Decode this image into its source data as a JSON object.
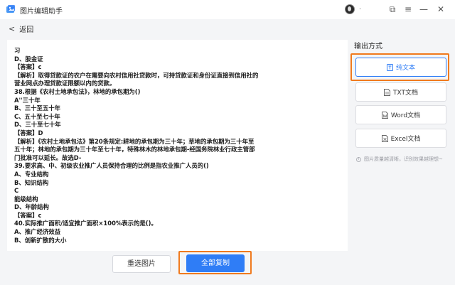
{
  "app": {
    "title": "图片编辑助手",
    "user_name": "."
  },
  "window_controls": {
    "restore": "⧉",
    "menu": "≡",
    "minimize": "—",
    "close": "✕"
  },
  "nav": {
    "back_label": "返回"
  },
  "content": {
    "lines": [
      "习",
      "D、股金证",
      "【答案】c",
      "【解析】取得贷款证的农户在需要向农村信用社贷款时，可持贷款证和身份证直接到信用社的",
      "营业网点办理贷款证限额以内的贷款。",
      "38.根据《农村土地承包法》，林地的承包期为()",
      "A''三十年",
      "B、三十至五十年",
      "C、五十至七十年",
      "D、三十至七十年",
      "【答案】D",
      "【解析】《农村土地承包法》第20条规定:耕地的承包期为三十年；草地的承包期为三十年至",
      "五十年；林地的承包期为三十年至七十年，特殊林木的林地承包期-经国务院林业行政主管部",
      "门批准可以延长。故选D-",
      "39.要求高、中、初级农业推广人员保持合理的比例是指农业推广人员的()",
      "A、专业结构",
      "B、知识结构",
      "C",
      "能级结构",
      "D、年龄结构",
      "【答案】c",
      "40.实际推广面积/适宜推广面积×100%表示的是()。",
      "A、推广经济效益",
      "B、创新扩散的大小"
    ]
  },
  "actions": {
    "reselect_label": "重选图片",
    "copy_all_label": "全部复制"
  },
  "output": {
    "title": "输出方式",
    "options": [
      {
        "label": "纯文本",
        "icon": "text-icon",
        "selected": true
      },
      {
        "label": "TXT文档",
        "icon": "txt-file-icon",
        "selected": false
      },
      {
        "label": "Word文档",
        "icon": "word-file-icon",
        "selected": false
      },
      {
        "label": "Excel文档",
        "icon": "excel-file-icon",
        "selected": false
      }
    ],
    "tip": "图片质量越清晰，识别效果越理想~"
  },
  "colors": {
    "accent": "#2f7df6",
    "highlight": "#f07a1e",
    "background": "#f4f5f7"
  }
}
